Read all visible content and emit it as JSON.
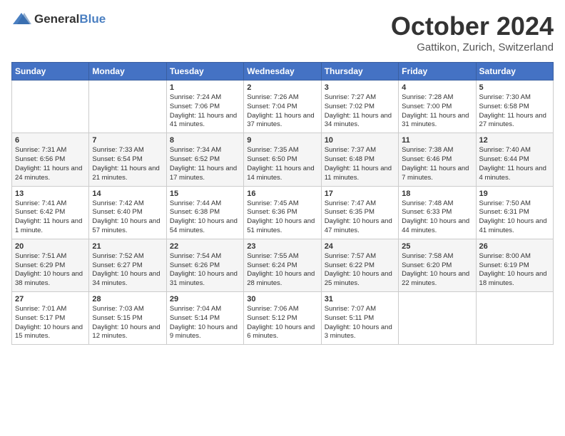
{
  "header": {
    "logo_general": "General",
    "logo_blue": "Blue",
    "month": "October 2024",
    "location": "Gattikon, Zurich, Switzerland"
  },
  "weekdays": [
    "Sunday",
    "Monday",
    "Tuesday",
    "Wednesday",
    "Thursday",
    "Friday",
    "Saturday"
  ],
  "weeks": [
    [
      {
        "day": "",
        "sunrise": "",
        "sunset": "",
        "daylight": ""
      },
      {
        "day": "",
        "sunrise": "",
        "sunset": "",
        "daylight": ""
      },
      {
        "day": "1",
        "sunrise": "Sunrise: 7:24 AM",
        "sunset": "Sunset: 7:06 PM",
        "daylight": "Daylight: 11 hours and 41 minutes."
      },
      {
        "day": "2",
        "sunrise": "Sunrise: 7:26 AM",
        "sunset": "Sunset: 7:04 PM",
        "daylight": "Daylight: 11 hours and 37 minutes."
      },
      {
        "day": "3",
        "sunrise": "Sunrise: 7:27 AM",
        "sunset": "Sunset: 7:02 PM",
        "daylight": "Daylight: 11 hours and 34 minutes."
      },
      {
        "day": "4",
        "sunrise": "Sunrise: 7:28 AM",
        "sunset": "Sunset: 7:00 PM",
        "daylight": "Daylight: 11 hours and 31 minutes."
      },
      {
        "day": "5",
        "sunrise": "Sunrise: 7:30 AM",
        "sunset": "Sunset: 6:58 PM",
        "daylight": "Daylight: 11 hours and 27 minutes."
      }
    ],
    [
      {
        "day": "6",
        "sunrise": "Sunrise: 7:31 AM",
        "sunset": "Sunset: 6:56 PM",
        "daylight": "Daylight: 11 hours and 24 minutes."
      },
      {
        "day": "7",
        "sunrise": "Sunrise: 7:33 AM",
        "sunset": "Sunset: 6:54 PM",
        "daylight": "Daylight: 11 hours and 21 minutes."
      },
      {
        "day": "8",
        "sunrise": "Sunrise: 7:34 AM",
        "sunset": "Sunset: 6:52 PM",
        "daylight": "Daylight: 11 hours and 17 minutes."
      },
      {
        "day": "9",
        "sunrise": "Sunrise: 7:35 AM",
        "sunset": "Sunset: 6:50 PM",
        "daylight": "Daylight: 11 hours and 14 minutes."
      },
      {
        "day": "10",
        "sunrise": "Sunrise: 7:37 AM",
        "sunset": "Sunset: 6:48 PM",
        "daylight": "Daylight: 11 hours and 11 minutes."
      },
      {
        "day": "11",
        "sunrise": "Sunrise: 7:38 AM",
        "sunset": "Sunset: 6:46 PM",
        "daylight": "Daylight: 11 hours and 7 minutes."
      },
      {
        "day": "12",
        "sunrise": "Sunrise: 7:40 AM",
        "sunset": "Sunset: 6:44 PM",
        "daylight": "Daylight: 11 hours and 4 minutes."
      }
    ],
    [
      {
        "day": "13",
        "sunrise": "Sunrise: 7:41 AM",
        "sunset": "Sunset: 6:42 PM",
        "daylight": "Daylight: 11 hours and 1 minute."
      },
      {
        "day": "14",
        "sunrise": "Sunrise: 7:42 AM",
        "sunset": "Sunset: 6:40 PM",
        "daylight": "Daylight: 10 hours and 57 minutes."
      },
      {
        "day": "15",
        "sunrise": "Sunrise: 7:44 AM",
        "sunset": "Sunset: 6:38 PM",
        "daylight": "Daylight: 10 hours and 54 minutes."
      },
      {
        "day": "16",
        "sunrise": "Sunrise: 7:45 AM",
        "sunset": "Sunset: 6:36 PM",
        "daylight": "Daylight: 10 hours and 51 minutes."
      },
      {
        "day": "17",
        "sunrise": "Sunrise: 7:47 AM",
        "sunset": "Sunset: 6:35 PM",
        "daylight": "Daylight: 10 hours and 47 minutes."
      },
      {
        "day": "18",
        "sunrise": "Sunrise: 7:48 AM",
        "sunset": "Sunset: 6:33 PM",
        "daylight": "Daylight: 10 hours and 44 minutes."
      },
      {
        "day": "19",
        "sunrise": "Sunrise: 7:50 AM",
        "sunset": "Sunset: 6:31 PM",
        "daylight": "Daylight: 10 hours and 41 minutes."
      }
    ],
    [
      {
        "day": "20",
        "sunrise": "Sunrise: 7:51 AM",
        "sunset": "Sunset: 6:29 PM",
        "daylight": "Daylight: 10 hours and 38 minutes."
      },
      {
        "day": "21",
        "sunrise": "Sunrise: 7:52 AM",
        "sunset": "Sunset: 6:27 PM",
        "daylight": "Daylight: 10 hours and 34 minutes."
      },
      {
        "day": "22",
        "sunrise": "Sunrise: 7:54 AM",
        "sunset": "Sunset: 6:26 PM",
        "daylight": "Daylight: 10 hours and 31 minutes."
      },
      {
        "day": "23",
        "sunrise": "Sunrise: 7:55 AM",
        "sunset": "Sunset: 6:24 PM",
        "daylight": "Daylight: 10 hours and 28 minutes."
      },
      {
        "day": "24",
        "sunrise": "Sunrise: 7:57 AM",
        "sunset": "Sunset: 6:22 PM",
        "daylight": "Daylight: 10 hours and 25 minutes."
      },
      {
        "day": "25",
        "sunrise": "Sunrise: 7:58 AM",
        "sunset": "Sunset: 6:20 PM",
        "daylight": "Daylight: 10 hours and 22 minutes."
      },
      {
        "day": "26",
        "sunrise": "Sunrise: 8:00 AM",
        "sunset": "Sunset: 6:19 PM",
        "daylight": "Daylight: 10 hours and 18 minutes."
      }
    ],
    [
      {
        "day": "27",
        "sunrise": "Sunrise: 7:01 AM",
        "sunset": "Sunset: 5:17 PM",
        "daylight": "Daylight: 10 hours and 15 minutes."
      },
      {
        "day": "28",
        "sunrise": "Sunrise: 7:03 AM",
        "sunset": "Sunset: 5:15 PM",
        "daylight": "Daylight: 10 hours and 12 minutes."
      },
      {
        "day": "29",
        "sunrise": "Sunrise: 7:04 AM",
        "sunset": "Sunset: 5:14 PM",
        "daylight": "Daylight: 10 hours and 9 minutes."
      },
      {
        "day": "30",
        "sunrise": "Sunrise: 7:06 AM",
        "sunset": "Sunset: 5:12 PM",
        "daylight": "Daylight: 10 hours and 6 minutes."
      },
      {
        "day": "31",
        "sunrise": "Sunrise: 7:07 AM",
        "sunset": "Sunset: 5:11 PM",
        "daylight": "Daylight: 10 hours and 3 minutes."
      },
      {
        "day": "",
        "sunrise": "",
        "sunset": "",
        "daylight": ""
      },
      {
        "day": "",
        "sunrise": "",
        "sunset": "",
        "daylight": ""
      }
    ]
  ]
}
